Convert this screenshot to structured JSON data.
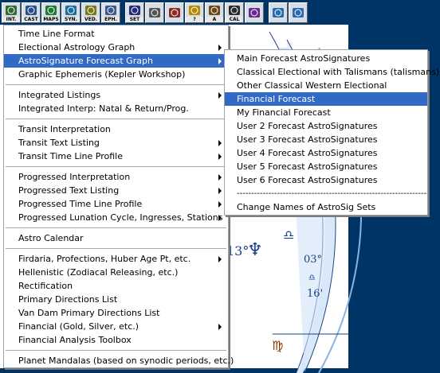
{
  "toolbar": {
    "buttons": [
      {
        "id": "int",
        "label": "INT.",
        "color": "#2f6b2f"
      },
      {
        "id": "cast",
        "label": "CAST",
        "color": "#2b4f8a"
      },
      {
        "id": "maps",
        "label": "MAPS",
        "color": "#1f7a3a"
      },
      {
        "id": "syn",
        "label": "SYN.",
        "color": "#1f6d9a"
      },
      {
        "id": "ved",
        "label": "VED.",
        "color": "#7a7a1a"
      },
      {
        "id": "eph",
        "label": "EPH.",
        "color": "#3b5a8a"
      },
      {
        "id": "set",
        "label": "SET",
        "color": "#2a2a7a"
      },
      {
        "id": "clock",
        "label": "",
        "color": "#555555"
      },
      {
        "id": "chart2",
        "label": "",
        "color": "#8a2a2a"
      },
      {
        "id": "help",
        "label": "?",
        "color": "#b48a00"
      },
      {
        "id": "text",
        "label": "A",
        "color": "#6a4a1a"
      },
      {
        "id": "cal",
        "label": "CAL",
        "color": "#2a2a2a"
      },
      {
        "id": "planet",
        "label": "",
        "color": "#6a2a8a"
      },
      {
        "id": "zoom-in",
        "label": "",
        "color": "#2a6ab0"
      },
      {
        "id": "zoom-out",
        "label": "",
        "color": "#2a6ab0"
      }
    ]
  },
  "chart": {
    "degree_left": "13°",
    "degree_right": "03°",
    "minutes_right": "16'",
    "glyph_neptune": "♆",
    "glyph_libra": "♎",
    "glyph_libra_small": "♎",
    "glyph_virgo": "♍"
  },
  "main_menu": {
    "items": [
      {
        "label": "Time Line Format",
        "submenu": false
      },
      {
        "label": "Electional Astrology Graph",
        "submenu": true
      },
      {
        "label": "AstroSignature Forecast Graph",
        "submenu": true,
        "highlighted": true
      },
      {
        "label": "Graphic Ephemeris   (Kepler Workshop)",
        "submenu": false
      },
      {
        "separator": true
      },
      {
        "label": "Integrated Listings",
        "submenu": true
      },
      {
        "label": "Integrated Interp: Natal & Return/Prog.",
        "submenu": false
      },
      {
        "separator": true
      },
      {
        "label": "Transit Interpretation",
        "submenu": false
      },
      {
        "label": "Transit Text Listing",
        "submenu": true
      },
      {
        "label": "Transit Time Line Profile",
        "submenu": true
      },
      {
        "separator": true
      },
      {
        "label": "Progressed Interpretation",
        "submenu": true
      },
      {
        "label": "Progressed Text Listing",
        "submenu": true
      },
      {
        "label": "Progressed Time Line Profile",
        "submenu": true
      },
      {
        "label": "Progressed Lunation Cycle, Ingresses, Stations",
        "submenu": true
      },
      {
        "separator": true
      },
      {
        "label": "Astro Calendar",
        "submenu": false
      },
      {
        "separator": true
      },
      {
        "label": "Firdaria, Profections, Huber Age Pt,  etc.",
        "submenu": true
      },
      {
        "label": "Hellenistic (Zodiacal Releasing, etc.)",
        "submenu": false
      },
      {
        "label": "Rectification",
        "submenu": false
      },
      {
        "label": "Primary Directions List",
        "submenu": false
      },
      {
        "label": "Van Dam Primary Directions List",
        "submenu": false
      },
      {
        "label": "Financial (Gold, Silver, etc.)",
        "submenu": true
      },
      {
        "label": "Financial Analysis Toolbox",
        "submenu": false
      },
      {
        "separator": true
      },
      {
        "label": "Planet Mandalas (based on synodic periods, etc.)",
        "submenu": false
      }
    ]
  },
  "sub_menu": {
    "items": [
      {
        "label": "Main Forecast AstroSignatures"
      },
      {
        "label": "Classical Electional with Talismans (talismans)"
      },
      {
        "label": "Other Classical Western Electional"
      },
      {
        "label": "Financial Forecast",
        "highlighted": true
      },
      {
        "label": "My Financial Forecast"
      },
      {
        "label": "User 2 Forecast AstroSignatures"
      },
      {
        "label": "User 3 Forecast AstroSignatures"
      },
      {
        "label": "User 4 Forecast AstroSignatures"
      },
      {
        "label": "User 5 Forecast AstroSignatures"
      },
      {
        "label": "User 6 Forecast AstroSignatures"
      },
      {
        "label": "--------------------------------------------------------------------",
        "divider_text": true
      },
      {
        "label": "Change Names of AstroSig Sets",
        "centered": true
      }
    ]
  }
}
